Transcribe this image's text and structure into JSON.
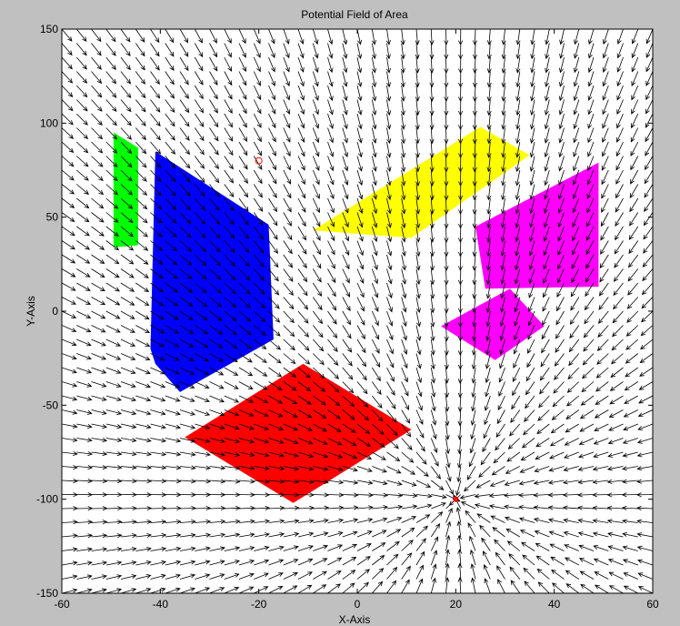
{
  "chart_data": {
    "type": "quiver",
    "title": "Potential Field of Area",
    "xlabel": "X-Axis",
    "ylabel": "Y-Axis",
    "xlim": [
      -60,
      60
    ],
    "ylim": [
      -150,
      150
    ],
    "xticks": [
      -60,
      -40,
      -20,
      0,
      20,
      40,
      60
    ],
    "yticks": [
      -150,
      -100,
      -50,
      0,
      50,
      100,
      150
    ],
    "xtick_labels": [
      "-60",
      "-40",
      "-20",
      "0",
      "20",
      "40",
      "60"
    ],
    "ytick_labels": [
      "-150",
      "-100",
      "-50",
      "0",
      "50",
      "100",
      "150"
    ],
    "grid": false,
    "background_color": "#ffffff",
    "field": {
      "goal": [
        20,
        -100
      ],
      "goal_color": "#ff0000",
      "x_start": -60,
      "x_end": 60,
      "x_step": 3,
      "y_start": -150,
      "y_end": 150,
      "y_step": 7.5,
      "arrow_color": "#000000"
    },
    "start_marker": {
      "x": -20,
      "y": 80,
      "color": "#ff0000"
    },
    "obstacles": [
      {
        "name": "green",
        "color": "#00ff00",
        "points": [
          [
            -49.5,
            95
          ],
          [
            -44.5,
            87
          ],
          [
            -44.5,
            35
          ],
          [
            -49.5,
            34
          ]
        ]
      },
      {
        "name": "blue",
        "color": "#0000ff",
        "points": [
          [
            -41,
            85
          ],
          [
            -18,
            46
          ],
          [
            -17,
            -15
          ],
          [
            -36,
            -43
          ],
          [
            -41,
            -28
          ],
          [
            -42,
            -20
          ]
        ]
      },
      {
        "name": "yellow",
        "color": "#ffff00",
        "points": [
          [
            -9,
            43
          ],
          [
            25,
            98
          ],
          [
            35,
            83
          ],
          [
            11,
            39
          ]
        ]
      },
      {
        "name": "magenta-upper",
        "color": "#ff00ff",
        "points": [
          [
            24,
            45
          ],
          [
            49,
            79
          ],
          [
            49,
            13
          ],
          [
            26,
            12
          ]
        ]
      },
      {
        "name": "magenta-lower",
        "color": "#ff00ff",
        "points": [
          [
            31,
            12
          ],
          [
            17,
            -8
          ],
          [
            28,
            -26
          ],
          [
            38,
            -8
          ]
        ]
      },
      {
        "name": "red",
        "color": "#ff0000",
        "points": [
          [
            -11,
            -28
          ],
          [
            11,
            -63
          ],
          [
            -13,
            -102
          ],
          [
            -35,
            -67
          ]
        ]
      }
    ]
  }
}
